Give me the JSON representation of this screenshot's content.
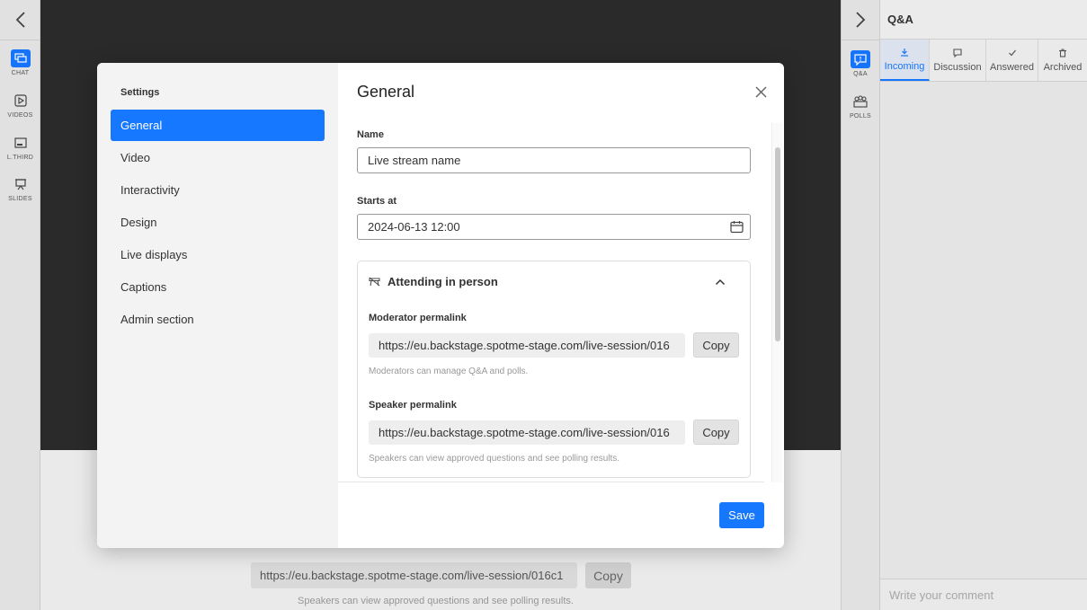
{
  "left_rail": {
    "items": [
      {
        "label": "CHAT",
        "icon": "chat-icon"
      },
      {
        "label": "VIDEOS",
        "icon": "video-icon"
      },
      {
        "label": "L.THIRD",
        "icon": "lower-third-icon"
      },
      {
        "label": "SLIDES",
        "icon": "slides-icon"
      }
    ]
  },
  "background": {
    "link_text": "https://eu.backstage.spotme-stage.com/live-session/016c1",
    "copy_label": "Copy",
    "help_text": "Speakers can view approved questions and see polling results."
  },
  "right_rail": {
    "items": [
      {
        "label": "Q&A",
        "icon": "qa-icon"
      },
      {
        "label": "POLLS",
        "icon": "polls-icon"
      }
    ]
  },
  "right_panel": {
    "title": "Q&A",
    "tabs": [
      {
        "label": "Incoming",
        "icon": "download-icon"
      },
      {
        "label": "Discussion",
        "icon": "comment-icon"
      },
      {
        "label": "Answered",
        "icon": "check-icon"
      },
      {
        "label": "Archived",
        "icon": "trash-icon"
      }
    ],
    "comment_placeholder": "Write your comment"
  },
  "modal": {
    "sidebar_title": "Settings",
    "nav": [
      "General",
      "Video",
      "Interactivity",
      "Design",
      "Live displays",
      "Captions",
      "Admin section"
    ],
    "title": "General",
    "name_label": "Name",
    "name_value": "Live stream name",
    "starts_label": "Starts at",
    "starts_value": "2024-06-13 12:00",
    "section_title": "Attending in person",
    "moderator_label": "Moderator permalink",
    "moderator_link": "https://eu.backstage.spotme-stage.com/live-session/016",
    "moderator_help": "Moderators can manage Q&A and polls.",
    "speaker_label": "Speaker permalink",
    "speaker_link": "https://eu.backstage.spotme-stage.com/live-session/016",
    "speaker_help": "Speakers can view approved questions and see polling results.",
    "copy_label": "Copy",
    "save_label": "Save"
  },
  "colors": {
    "accent": "#1677ff"
  }
}
